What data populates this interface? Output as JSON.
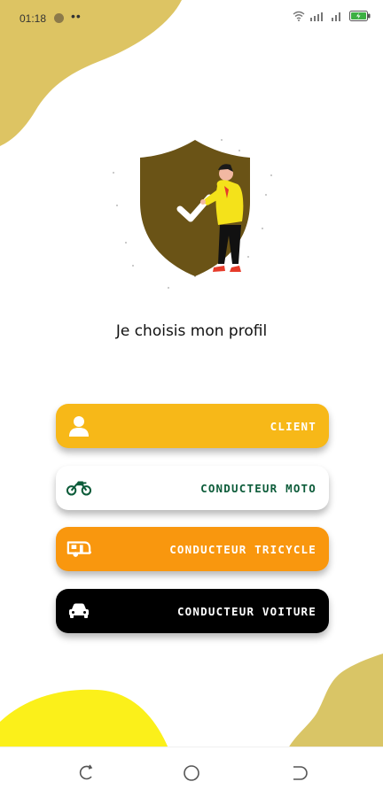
{
  "status_bar": {
    "time": "01:18",
    "more": "••",
    "battery_color": "#3cb043"
  },
  "colors": {
    "top_blob": "#ddc463",
    "bottom_left_blob": "#fbf01a",
    "bottom_right_blob": "#d9c566",
    "shield": "#6a5316",
    "client": "#f7b818",
    "moto": "#ffffff",
    "tricycle": "#f9970e",
    "voiture": "#000000"
  },
  "headline": "Je choisis mon profil",
  "profiles": {
    "client": {
      "label": "CLIENT",
      "icon": "person-icon"
    },
    "moto": {
      "label": "CONDUCTEUR MOTO",
      "icon": "motorcycle-icon"
    },
    "tricycle": {
      "label": "CONDUCTEUR TRICYCLE",
      "icon": "caravan-icon"
    },
    "voiture": {
      "label": "CONDUCTEUR VOITURE",
      "icon": "car-icon"
    }
  },
  "nav": {
    "recents": "recents-icon",
    "home": "home-icon",
    "back": "back-icon"
  }
}
